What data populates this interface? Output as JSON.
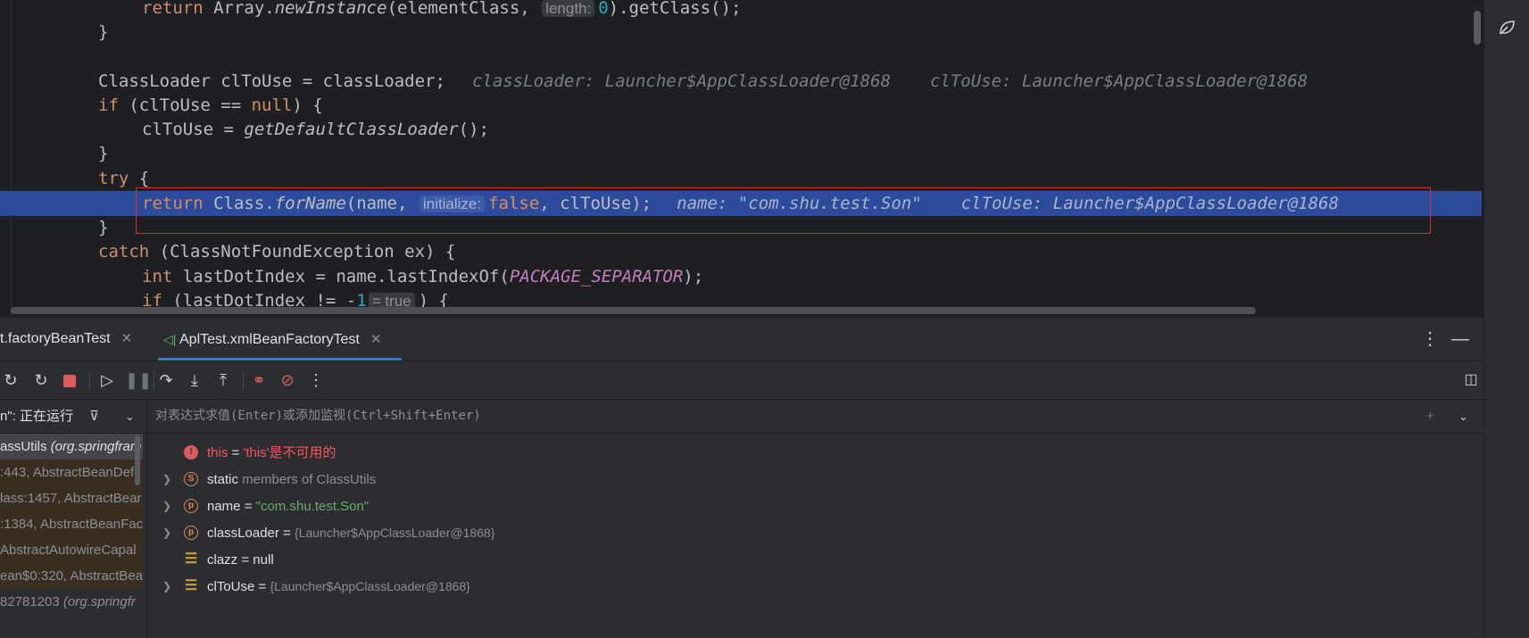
{
  "editor": {
    "lines": {
      "l1": {
        "kw": "return",
        "pre": " Array.",
        "fn": "newInstance",
        "mid": "(elementClass,",
        "hint": "length:",
        "num": "0",
        "post": ").getClass();"
      },
      "l2": "}",
      "l3": {
        "code": "ClassLoader clToUse = classLoader;",
        "debug1": "classLoader: Launcher$AppClassLoader@1868",
        "debug2": "clToUse: Launcher$AppClassLoader@1868"
      },
      "l4": {
        "kw": "if",
        "pre": " (clToUse == ",
        "kw2": "null",
        "post": ") {"
      },
      "l5": {
        "pre": "clToUse = ",
        "fn": "getDefaultClassLoader",
        "post": "();"
      },
      "l6": "}",
      "l7": {
        "kw": "try",
        "post": " {"
      },
      "l8": {
        "kw": "return",
        "pre": " Class.",
        "fn": "forName",
        "mid": "(name,",
        "hint": "initialize:",
        "kw2": "false",
        "post": ", clToUse);",
        "debug1": "name: \"com.shu.test.Son\"",
        "debug2": "clToUse: Launcher$AppClassLoader@1868"
      },
      "l9": "}",
      "l10": {
        "kw": "catch",
        "post": " (ClassNotFoundException ex) {"
      },
      "l11": {
        "kw": "int",
        "pre": " lastDotIndex = name.lastIndexOf(",
        "const": "PACKAGE_SEPARATOR",
        "post": ");"
      },
      "l12": {
        "kw": "if",
        "pre": " (lastDotIndex != -",
        "num": "1",
        "hint": "= true",
        "post": ") {"
      }
    }
  },
  "debug": {
    "tabs": [
      {
        "label": "t.factoryBeanTest"
      },
      {
        "label": "AplTest.xmlBeanFactoryTest"
      }
    ],
    "thread": "n\": 正在运行",
    "frames": [
      {
        "main": "assUtils ",
        "pkg": "(org.springfram"
      },
      {
        "main": ":443, AbstractBeanDefi",
        "pkg": ""
      },
      {
        "main": "lass:1457, AbstractBear",
        "pkg": ""
      },
      {
        "main": ":1384, AbstractBeanFac",
        "pkg": ""
      },
      {
        "main": "AbstractAutowireCapal",
        "pkg": ""
      },
      {
        "main": "ean$0:320, AbstractBea",
        "pkg": ""
      },
      {
        "main": "82781203 ",
        "pkg": "(org.springfr"
      }
    ],
    "eval_placeholder": "对表达式求值(Enter)或添加监视(Ctrl+Shift+Enter)",
    "variables": [
      {
        "name": "this",
        "eq": " = ",
        "value": "'this'是不可用的",
        "icon": "error-icon"
      },
      {
        "name": "static",
        "eq": " members of ClassUtils",
        "value": "",
        "icon": "static-icon"
      },
      {
        "name": "name",
        "eq": " = ",
        "value": "\"com.shu.test.Son\"",
        "icon": "parameter-icon"
      },
      {
        "name": "classLoader",
        "eq": " = ",
        "value": "{Launcher$AppClassLoader@1868}",
        "icon": "parameter-icon"
      },
      {
        "name": "clazz",
        "eq": " = ",
        "value": "null",
        "icon": "field-icon"
      },
      {
        "name": "clToUse",
        "eq": " = ",
        "value": "{Launcher$AppClassLoader@1868}",
        "icon": "field-icon"
      }
    ]
  },
  "colors": {
    "highlight": "#2d4b9b",
    "selection_border": "#d4313a",
    "accent": "#3574f0"
  }
}
